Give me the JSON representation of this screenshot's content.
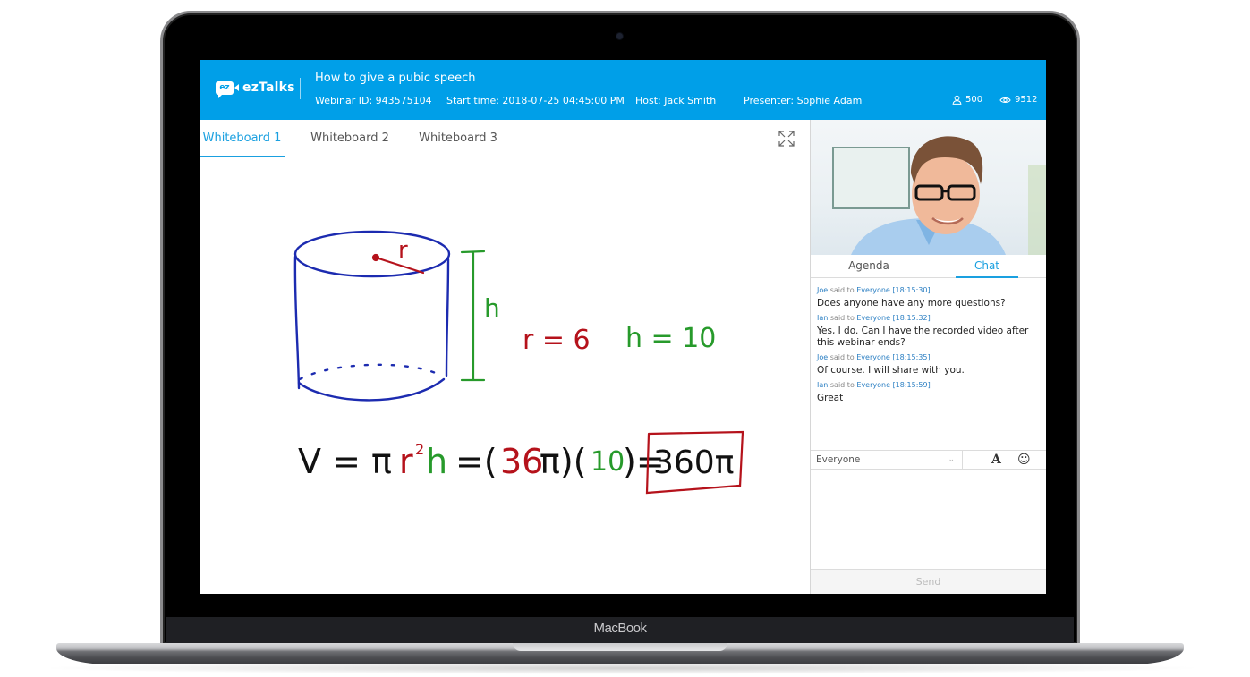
{
  "device": {
    "brand_label": "MacBook"
  },
  "header": {
    "logo_text": "ezTalks",
    "logo_badge": "ez",
    "title": "How to give a pubic speech",
    "webinar_id": "Webinar ID: 943575104",
    "start_time": "Start time: 2018-07-25 04:45:00 PM",
    "host": "Host: Jack Smith",
    "presenter": "Presenter: Sophie Adam",
    "attendees_count": "500",
    "views_count": "9512",
    "attendees_icon": "user-icon",
    "views_icon": "eye-icon",
    "brand_color": "#009fe8"
  },
  "whiteboard": {
    "tabs": [
      {
        "label": "Whiteboard 1",
        "active": true
      },
      {
        "label": "Whiteboard 2",
        "active": false
      },
      {
        "label": "Whiteboard 3",
        "active": false
      }
    ],
    "expand_icon": "fullscreen-expand-icon",
    "drawing": {
      "radius_label": "r",
      "height_label": "h",
      "given_r": "r = 6",
      "given_h": "h = 10",
      "formula": "V = π r² h = (36π)(10) = 360π",
      "result": "360π",
      "ink_colors": {
        "blue": "#1c2bb0",
        "red": "#b5121b",
        "green": "#279a2b",
        "black": "#111111"
      }
    }
  },
  "side_panel": {
    "tabs": [
      {
        "label": "Agenda",
        "active": false
      },
      {
        "label": "Chat",
        "active": true
      }
    ],
    "messages": [
      {
        "sender": "Joe",
        "said_to": "said to",
        "recipient": "Everyone",
        "time": "[18:15:30]",
        "text": "Does anyone have any more questions?"
      },
      {
        "sender": "Ian",
        "said_to": "said to",
        "recipient": "Everyone",
        "time": "[18:15:32]",
        "text": "Yes, I do. Can I have the recorded video after this webinar ends?"
      },
      {
        "sender": "Joe",
        "said_to": "said to",
        "recipient": "Everyone",
        "time": "[18:15:35]",
        "text": "Of course. I will share with you."
      },
      {
        "sender": "Ian",
        "said_to": "said to",
        "recipient": "Everyone",
        "time": "[18:15:59]",
        "text": "Great"
      }
    ],
    "recipient_select": {
      "value": "Everyone"
    },
    "font_button": "A",
    "emoji_button": "☺",
    "message_input": {
      "value": "",
      "placeholder": ""
    },
    "send_label": "Send"
  }
}
